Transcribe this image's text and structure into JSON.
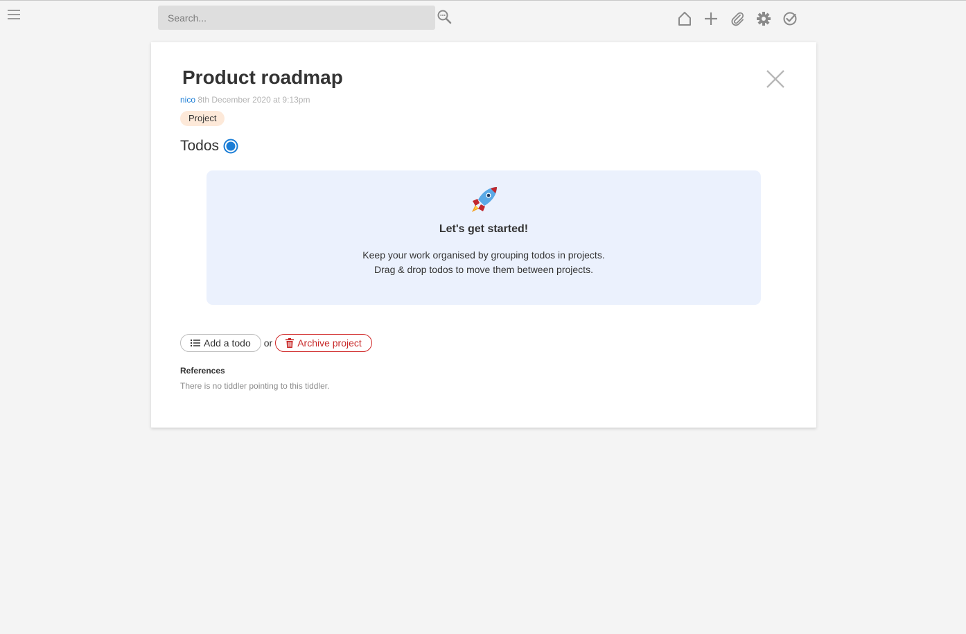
{
  "topbar": {
    "search_placeholder": "Search...",
    "icons": [
      "menu-icon",
      "search-icon",
      "home-icon",
      "new-tiddler-icon",
      "paperclip-icon",
      "gear-icon",
      "check-circle-icon"
    ]
  },
  "tiddler": {
    "title": "Product roadmap",
    "modifier": "nico",
    "modified": "8th December 2020 at 9:13pm",
    "tag": "Project",
    "todos_heading": "Todos",
    "empty_state": {
      "icon": "rocket-icon",
      "heading": "Let's get started!",
      "line1": "Keep your work organised by grouping todos in projects.",
      "line2": "Drag & drop todos to move them between projects."
    },
    "actions": {
      "add_label": "Add a todo",
      "or_text": "or",
      "archive_label": "Archive project"
    },
    "references": {
      "heading": "References",
      "text": "There is no tiddler pointing to this tiddler."
    }
  },
  "colors": {
    "link_blue": "#1a7dd6",
    "tag_bg": "#fde9d9",
    "panel_bg": "#ebf1fd",
    "danger_red": "#c72626"
  }
}
